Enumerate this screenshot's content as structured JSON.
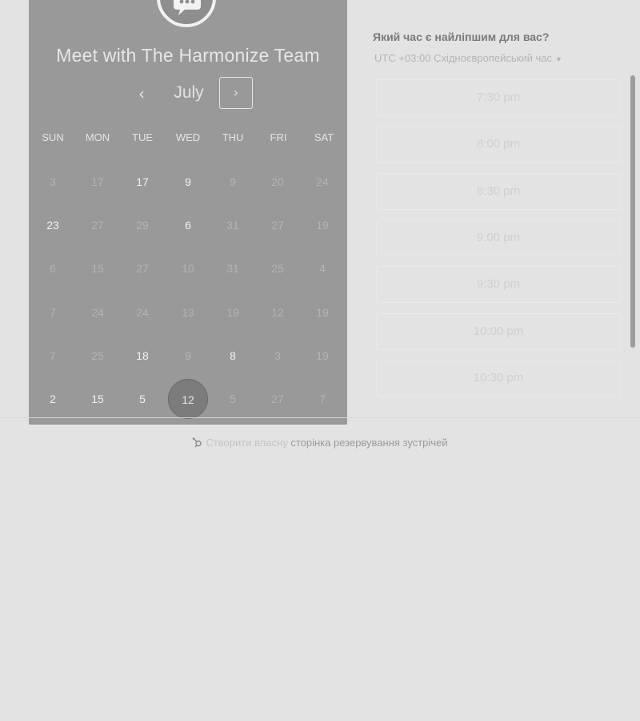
{
  "meeting": {
    "title": "Meet with The Harmonize Team"
  },
  "calendar": {
    "month": "July",
    "prev_icon": "chevron-left-icon",
    "next_icon": "chevron-right-icon",
    "weekdays": [
      "SUN",
      "MON",
      "TUE",
      "WED",
      "THU",
      "FRI",
      "SAT"
    ],
    "weeks": [
      [
        {
          "d": "3",
          "a": false
        },
        {
          "d": "17",
          "a": false
        },
        {
          "d": "17",
          "a": true
        },
        {
          "d": "9",
          "a": true
        },
        {
          "d": "9",
          "a": false
        },
        {
          "d": "20",
          "a": false
        },
        {
          "d": "24",
          "a": false
        }
      ],
      [
        {
          "d": "23",
          "a": true
        },
        {
          "d": "27",
          "a": false
        },
        {
          "d": "29",
          "a": false
        },
        {
          "d": "6",
          "a": true
        },
        {
          "d": "31",
          "a": false
        },
        {
          "d": "27",
          "a": false
        },
        {
          "d": "19",
          "a": false
        }
      ],
      [
        {
          "d": "6",
          "a": false
        },
        {
          "d": "15",
          "a": false
        },
        {
          "d": "27",
          "a": false
        },
        {
          "d": "10",
          "a": false
        },
        {
          "d": "31",
          "a": false
        },
        {
          "d": "25",
          "a": false
        },
        {
          "d": "4",
          "a": false
        }
      ],
      [
        {
          "d": "7",
          "a": false
        },
        {
          "d": "24",
          "a": false
        },
        {
          "d": "24",
          "a": false
        },
        {
          "d": "13",
          "a": false
        },
        {
          "d": "19",
          "a": false
        },
        {
          "d": "12",
          "a": false
        },
        {
          "d": "19",
          "a": false
        }
      ],
      [
        {
          "d": "7",
          "a": false
        },
        {
          "d": "25",
          "a": false
        },
        {
          "d": "18",
          "a": true
        },
        {
          "d": "9",
          "a": false
        },
        {
          "d": "8",
          "a": true
        },
        {
          "d": "3",
          "a": false
        },
        {
          "d": "19",
          "a": false
        }
      ],
      [
        {
          "d": "2",
          "a": true
        },
        {
          "d": "15",
          "a": true
        },
        {
          "d": "5",
          "a": true
        },
        {
          "d": "12",
          "a": true,
          "selected": true
        },
        {
          "d": "5",
          "a": false
        },
        {
          "d": "27",
          "a": false
        },
        {
          "d": "7",
          "a": false
        }
      ]
    ]
  },
  "times": {
    "question": "Який час є найліпшим для вас?",
    "timezone": "UTC +03:00 Східноєвропейський час",
    "slots": [
      "7:30 pm",
      "8:00 pm",
      "8:30 pm",
      "9:00 pm",
      "9:30 pm",
      "10:00 pm",
      "10:30 pm"
    ]
  },
  "footer": {
    "prefix": "Створити власну",
    "link": "сторінка резервування зустрічей"
  },
  "colors": {
    "panel": "#999999",
    "background": "#e3e3e3",
    "selected_day": "#7c7c7c"
  }
}
